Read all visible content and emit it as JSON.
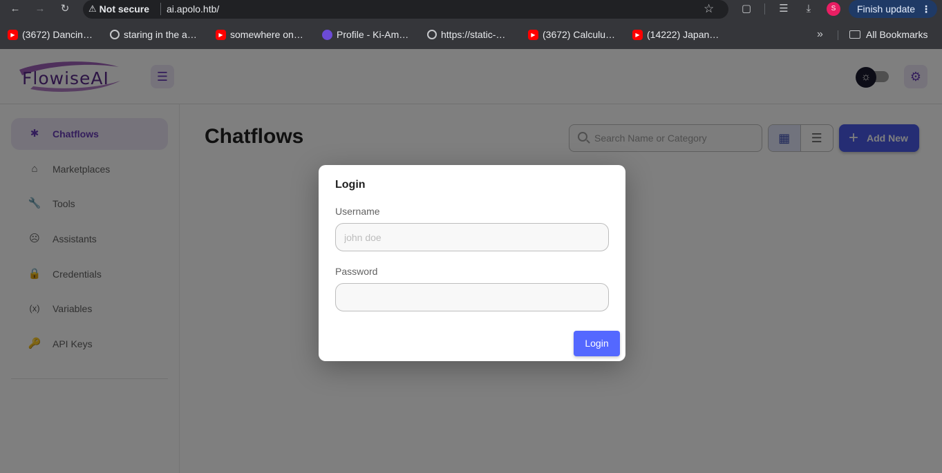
{
  "browser": {
    "security_label": "Not secure",
    "url": "ai.apolo.htb/",
    "update_label": "Finish update",
    "profile_initial": "S",
    "bookmarks": [
      {
        "label": "(3672) Dancin…",
        "icon": "youtube-icon"
      },
      {
        "label": "staring in the a…",
        "icon": "globe-icon"
      },
      {
        "label": "somewhere on…",
        "icon": "youtube-icon"
      },
      {
        "label": "Profile - Ki-Am…",
        "icon": "profile-site-icon"
      },
      {
        "label": "https://static-…",
        "icon": "globe-icon"
      },
      {
        "label": "(3672) Calculu…",
        "icon": "youtube-icon"
      },
      {
        "label": "(14222) Japan…",
        "icon": "youtube-icon"
      }
    ],
    "all_bookmarks_label": "All Bookmarks"
  },
  "app": {
    "logo_text": "FlowiseAI",
    "sidebar": {
      "items": [
        {
          "label": "Chatflows",
          "icon": "chatflow-icon",
          "active": true
        },
        {
          "label": "Marketplaces",
          "icon": "store-icon",
          "active": false
        },
        {
          "label": "Tools",
          "icon": "wrench-icon",
          "active": false
        },
        {
          "label": "Assistants",
          "icon": "robot-icon",
          "active": false
        },
        {
          "label": "Credentials",
          "icon": "lock-icon",
          "active": false
        },
        {
          "label": "Variables",
          "icon": "variable-icon",
          "active": false
        },
        {
          "label": "API Keys",
          "icon": "key-icon",
          "active": false
        }
      ]
    },
    "main": {
      "title": "Chatflows",
      "search_placeholder": "Search Name or Category",
      "add_new_label": "Add New"
    }
  },
  "login_dialog": {
    "title": "Login",
    "username_label": "Username",
    "username_placeholder": "john doe",
    "username_value": "",
    "password_label": "Password",
    "password_value": "",
    "submit_label": "Login"
  },
  "colors": {
    "accent": "#673ab7",
    "primary_button": "#4a5ae8",
    "login_button": "#5468ff",
    "chrome_bg": "#35363a"
  }
}
